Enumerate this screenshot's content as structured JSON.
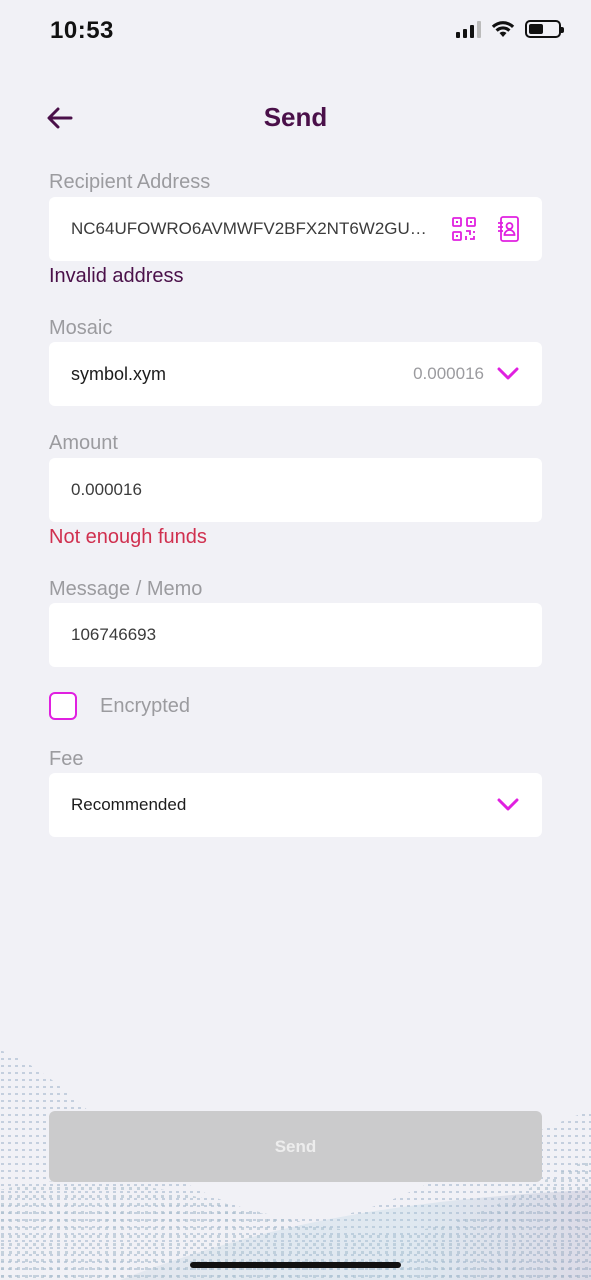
{
  "status": {
    "time": "10:53",
    "battery_level": 0.5
  },
  "header": {
    "title": "Send"
  },
  "recipient": {
    "label": "Recipient Address",
    "value": "NC64UFOWRO6AVMWFV2BFX2NT6W2GURK2...",
    "error": "Invalid address",
    "icons": [
      "qr-code-icon",
      "address-book-icon"
    ]
  },
  "mosaic": {
    "label": "Mosaic",
    "value": "symbol.xym",
    "balance": "0.000016"
  },
  "amount": {
    "label": "Amount",
    "value": "0.000016",
    "error": "Not enough funds"
  },
  "message": {
    "label": "Message / Memo",
    "value": "106746693"
  },
  "encrypted": {
    "label": "Encrypted",
    "checked": false
  },
  "fee": {
    "label": "Fee",
    "value": "Recommended"
  },
  "send_button": {
    "label": "Send",
    "enabled": false
  },
  "colors": {
    "accent": "#e020e0",
    "title": "#4a1049",
    "error_red": "#d0304f",
    "background": "#f1f1f6",
    "button_disabled": "#cbcbcc"
  }
}
